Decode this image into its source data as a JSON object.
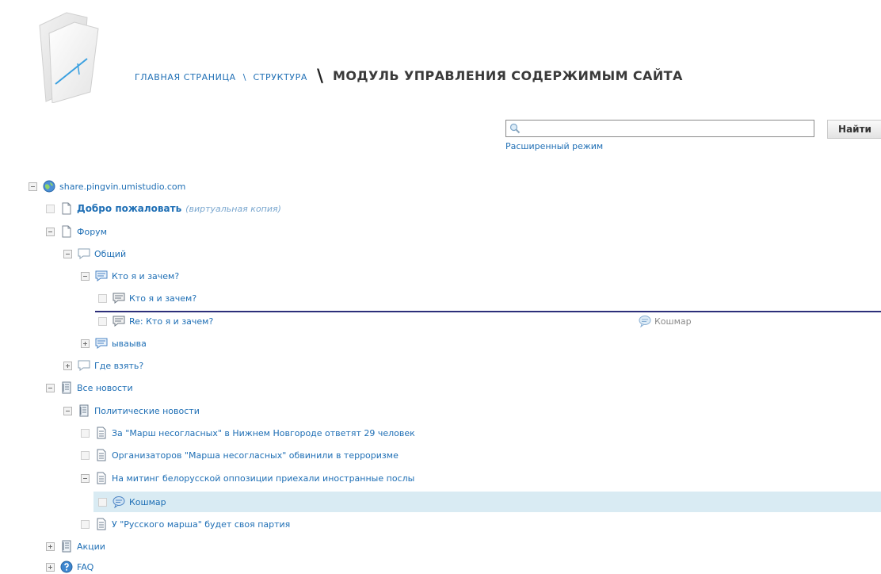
{
  "header": {
    "breadcrumbs": [
      "ГЛАВНАЯ СТРАНИЦА",
      "СТРУКТУРА"
    ],
    "separator": "\\",
    "big_separator": "\\",
    "title": "МОДУЛЬ УПРАВЛЕНИЯ СОДЕРЖИМЫМ САЙТА"
  },
  "search": {
    "value": "",
    "placeholder": "",
    "button_label": "Найти",
    "advanced_label": "Расширенный режим"
  },
  "tree": {
    "root": "share.pingvin.umistudio.com",
    "welcome": "Добро пожаловать",
    "welcome_note": "(виртуальная копия)",
    "forum": "Форум",
    "general": "Общий",
    "who_am_i": "Кто я и зачем?",
    "who_am_i_child": "Кто я и зачем?",
    "re_who_am_i": "Re: Кто я и зачем?",
    "yvayva": "ываыва",
    "where_to_get": "Где взять?",
    "all_news": "Все новости",
    "political_news": "Политические новости",
    "news1": "За \"Марш несогласных\" в Нижнем Новгороде ответят 29 человек",
    "news2": "Организаторов \"Марша несогласных\" обвинили в терроризме",
    "news3": "На митинг белорусской оппозиции приехали иностранные послы",
    "nightmare": "Кошмар",
    "news4": "У \"Русского марша\" будет своя партия",
    "actions": "Акции",
    "faq": "FAQ"
  },
  "drag": {
    "ghost_label": "Кошмар"
  },
  "colors": {
    "link": "#1f6fb5",
    "drop_line": "#2d2f7a",
    "selected_row": "#d9ebf3"
  }
}
